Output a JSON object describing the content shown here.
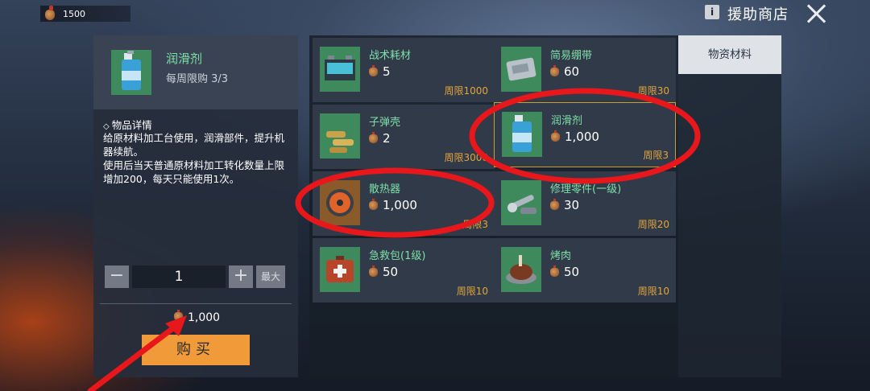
{
  "top_bar": {
    "currency_amount": "1500",
    "shop_title": "援助商店",
    "info_label": "i"
  },
  "detail": {
    "name": "润滑剂",
    "limit_text": "每周限购  3/3",
    "section_title": "物品详情",
    "desc_line1": "给原材料加工台使用，润滑部件，提升机器续航。",
    "desc_line2": "使用后当天普通原材料加工转化数量上限增加200，每天只能使用1次。",
    "minus_label": "−",
    "quantity": "1",
    "plus_label": "+",
    "max_label": "最大",
    "total_price": "1,000",
    "buy_label": "购买"
  },
  "items": [
    {
      "name": "战术耗材",
      "price": "5",
      "limit": "周限1000",
      "icon": "battery-icon"
    },
    {
      "name": "简易绷带",
      "price": "60",
      "limit": "周限30",
      "icon": "bandage-icon"
    },
    {
      "name": "子弹壳",
      "price": "2",
      "limit": "周限3000",
      "icon": "shell-casing-icon"
    },
    {
      "name": "润滑剂",
      "price": "1,000",
      "limit": "周限3",
      "icon": "spray-can-icon"
    },
    {
      "name": "散热器",
      "price": "1,000",
      "limit": "周限3",
      "icon": "cooling-fan-icon"
    },
    {
      "name": "修理零件(一级)",
      "price": "30",
      "limit": "周限20",
      "icon": "wrench-icon"
    },
    {
      "name": "急救包(1级)",
      "price": "50",
      "limit": "周限10",
      "icon": "first-aid-kit-icon"
    },
    {
      "name": "烤肉",
      "price": "50",
      "limit": "周限10",
      "icon": "roast-meat-icon"
    }
  ],
  "tabs": {
    "active": "物资材料"
  },
  "colors": {
    "accent_green": "#7ee0a8",
    "limit_orange": "#e3a43a",
    "buy_orange": "#f09a3a",
    "annotation_red": "#e8171b"
  }
}
